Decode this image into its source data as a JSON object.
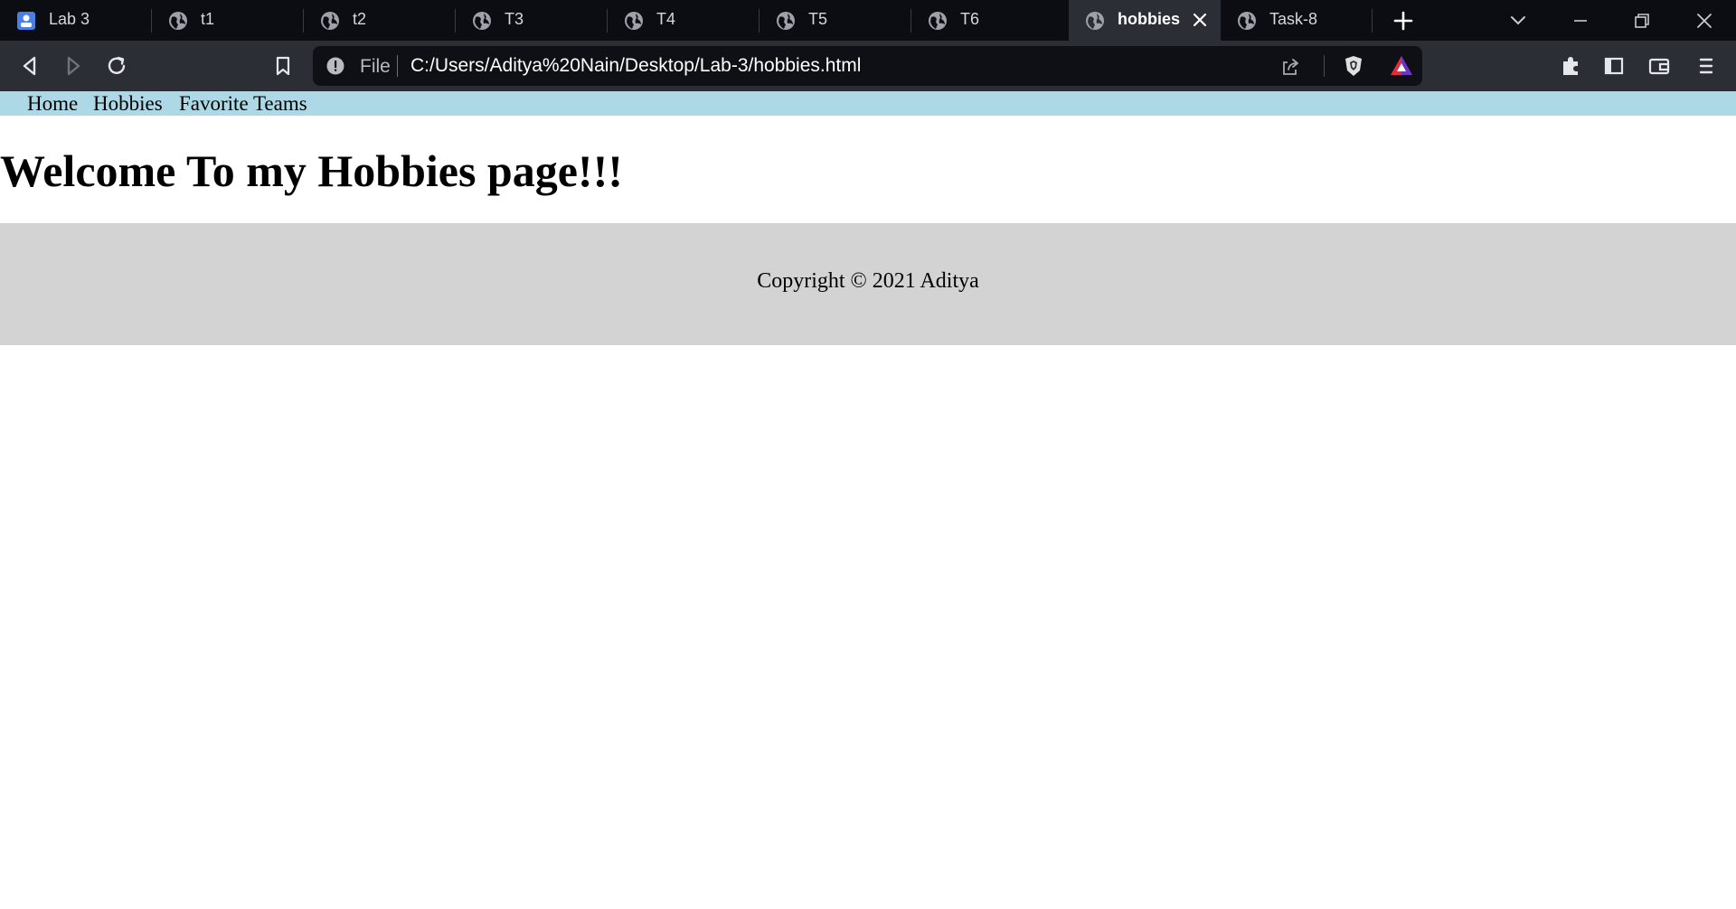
{
  "browser": {
    "tabs": [
      {
        "label": "Lab 3",
        "icon": "doc-favicon-icon",
        "active": false
      },
      {
        "label": "t1",
        "icon": "globe-icon",
        "active": false
      },
      {
        "label": "t2",
        "icon": "globe-icon",
        "active": false
      },
      {
        "label": "T3",
        "icon": "globe-icon",
        "active": false
      },
      {
        "label": "T4",
        "icon": "globe-icon",
        "active": false
      },
      {
        "label": "T5",
        "icon": "globe-icon",
        "active": false
      },
      {
        "label": "T6",
        "icon": "globe-icon",
        "active": false
      },
      {
        "label": "hobbies",
        "icon": "globe-icon",
        "active": true
      },
      {
        "label": "Task-8",
        "icon": "globe-icon",
        "active": false
      }
    ],
    "address": {
      "scheme_label": "File",
      "url": "C:/Users/Aditya%20Nain/Desktop/Lab-3/hobbies.html"
    },
    "colors": {
      "tabbar_bg": "#0c0d13",
      "toolbar_bg": "#2c2e35",
      "brave_shield": "#e0e0e0",
      "rewards_triangle_top": "#e12d39",
      "rewards_triangle_bottom": "#6b35c9"
    }
  },
  "page": {
    "nav": {
      "items": [
        "Home",
        "Hobbies",
        "Favorite Teams"
      ]
    },
    "heading": "Welcome To my Hobbies page!!!",
    "footer": {
      "text": "Copyright © 2021 Aditya"
    },
    "colors": {
      "nav_bg": "#add8e6",
      "footer_bg": "#d3d3d3"
    }
  }
}
